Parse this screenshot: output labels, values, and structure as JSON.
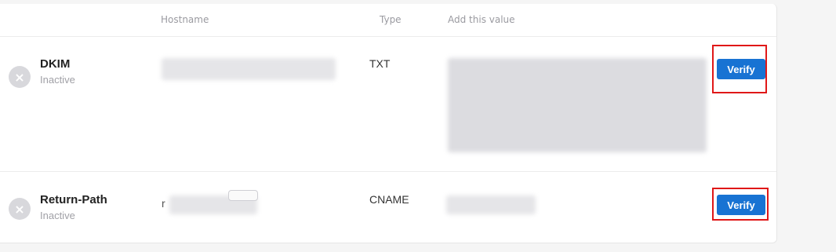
{
  "table": {
    "headers": {
      "hostname": "Hostname",
      "type": "Type",
      "value": "Add this value"
    },
    "records": [
      {
        "name": "DKIM",
        "status": "Inactive",
        "type": "TXT",
        "action": "Verify"
      },
      {
        "name": "Return-Path",
        "status": "Inactive",
        "host_prefix": "r",
        "type": "CNAME",
        "action": "Verify"
      }
    ]
  },
  "icons": {
    "inactive_status": "close-circle-icon"
  },
  "colors": {
    "verify_button": "#1873d3",
    "highlight_box": "#e01818",
    "inactive_icon": "#d8d8dc"
  }
}
